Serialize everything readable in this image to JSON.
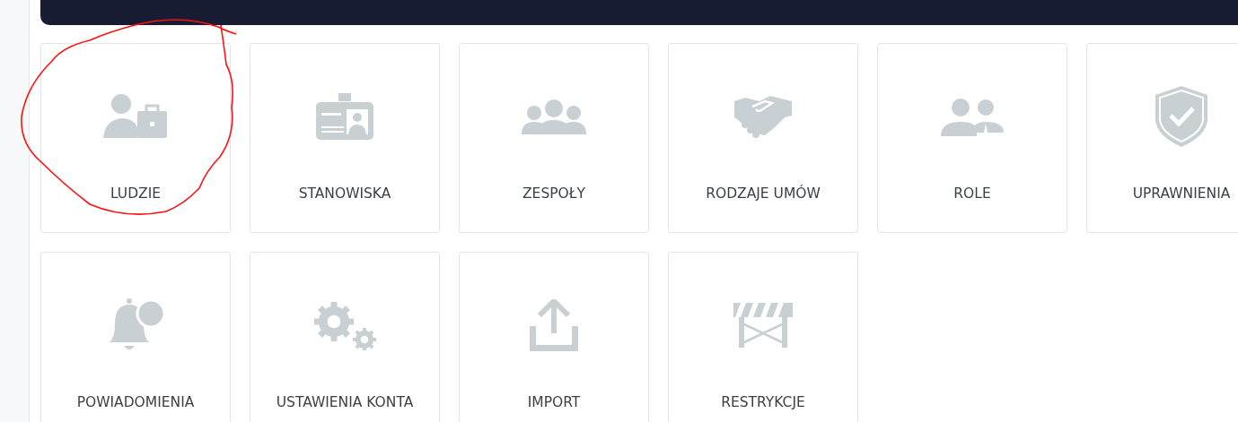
{
  "tiles": [
    {
      "label": "LUDZIE",
      "kind": "person-briefcase",
      "circled": true
    },
    {
      "label": "STANOWISKA",
      "kind": "id-card",
      "circled": false
    },
    {
      "label": "ZESPOŁY",
      "kind": "group",
      "circled": false
    },
    {
      "label": "RODZAJE UMÓW",
      "kind": "handshake",
      "circled": false
    },
    {
      "label": "ROLE",
      "kind": "pair",
      "circled": false
    },
    {
      "label": "UPRAWNIENIA",
      "kind": "shield",
      "circled": false
    },
    {
      "label": "POWIADOMIENIA",
      "kind": "bell",
      "circled": false
    },
    {
      "label": "USTAWIENIA KONTA",
      "kind": "gears",
      "circled": false
    },
    {
      "label": "IMPORT",
      "kind": "upload",
      "circled": false
    },
    {
      "label": "RESTRYKCJE",
      "kind": "barrier",
      "circled": false
    }
  ]
}
